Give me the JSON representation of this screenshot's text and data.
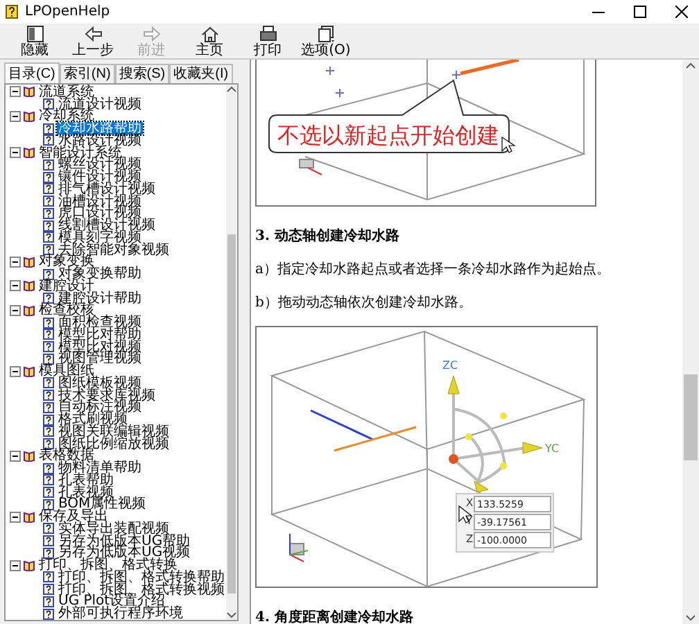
{
  "window": {
    "title": "LPOpenHelp"
  },
  "toolbar": [
    {
      "kind": "hide",
      "label": "隐藏",
      "disabled": false
    },
    {
      "kind": "back",
      "label": "上一步",
      "disabled": false
    },
    {
      "kind": "forward",
      "label": "前进",
      "disabled": true
    },
    {
      "kind": "home",
      "label": "主页",
      "disabled": false
    },
    {
      "kind": "print",
      "label": "打印",
      "disabled": false
    },
    {
      "kind": "options",
      "label": "选项(O)",
      "disabled": false
    }
  ],
  "tabs": [
    {
      "label": "目录(C)",
      "selected": true
    },
    {
      "label": "索引(N)",
      "selected": false
    },
    {
      "label": "搜索(S)",
      "selected": false
    },
    {
      "label": "收藏夹(I)",
      "selected": false
    }
  ],
  "tree": [
    {
      "label": "流道系统",
      "expanded": true,
      "selected": false,
      "children": [
        {
          "label": "流道设计视频",
          "selected": false
        }
      ]
    },
    {
      "label": "冷却系统",
      "expanded": true,
      "selected": false,
      "children": [
        {
          "label": "冷却水路帮助",
          "selected": true
        },
        {
          "label": "水路设计视频",
          "selected": false
        }
      ]
    },
    {
      "label": "智能设计系统",
      "expanded": true,
      "selected": false,
      "children": [
        {
          "label": "螺丝设计视频",
          "selected": false
        },
        {
          "label": "镶件设计视频",
          "selected": false
        },
        {
          "label": "排气槽设计视频",
          "selected": false
        },
        {
          "label": "油槽设计视频",
          "selected": false
        },
        {
          "label": "虎口设计视频",
          "selected": false
        },
        {
          "label": "线割槽设计视频",
          "selected": false
        },
        {
          "label": "模具刻字视频",
          "selected": false
        },
        {
          "label": "去除智能对象视频",
          "selected": false
        }
      ]
    },
    {
      "label": "对象变换",
      "expanded": true,
      "selected": false,
      "children": [
        {
          "label": "对象变换帮助",
          "selected": false
        }
      ]
    },
    {
      "label": "建腔设计",
      "expanded": true,
      "selected": false,
      "children": [
        {
          "label": "建腔设计帮助",
          "selected": false
        }
      ]
    },
    {
      "label": "检查校核",
      "expanded": true,
      "selected": false,
      "children": [
        {
          "label": "面积检查视频",
          "selected": false
        },
        {
          "label": "模型比对帮助",
          "selected": false
        },
        {
          "label": "模型比对视频",
          "selected": false
        },
        {
          "label": "视图管理视频",
          "selected": false
        }
      ]
    },
    {
      "label": "模具图纸",
      "expanded": true,
      "selected": false,
      "children": [
        {
          "label": "图纸模板视频",
          "selected": false
        },
        {
          "label": "技术要求库视频",
          "selected": false
        },
        {
          "label": "自动标注视频",
          "selected": false
        },
        {
          "label": "格式刷视频",
          "selected": false
        },
        {
          "label": "视图关联编辑视频",
          "selected": false
        },
        {
          "label": "图纸比例缩放视频",
          "selected": false
        }
      ]
    },
    {
      "label": "表格数据",
      "expanded": true,
      "selected": false,
      "children": [
        {
          "label": "物料清单帮助",
          "selected": false
        },
        {
          "label": "孔表帮助",
          "selected": false
        },
        {
          "label": "孔表视频",
          "selected": false
        },
        {
          "label": "BOM属性视频",
          "selected": false
        }
      ]
    },
    {
      "label": "保存及导出",
      "expanded": true,
      "selected": false,
      "children": [
        {
          "label": "实体导出装配视频",
          "selected": false
        },
        {
          "label": "另存为低版本UG帮助",
          "selected": false
        },
        {
          "label": "另存为低版本UG视频",
          "selected": false
        }
      ]
    },
    {
      "label": "打印、拆图、格式转换",
      "expanded": true,
      "selected": false,
      "children": [
        {
          "label": "打印、拆图、格式转换帮助",
          "selected": false
        },
        {
          "label": "打印、拆图、格式转换视频",
          "selected": false
        },
        {
          "label": "UG Plot设置介绍",
          "selected": false
        },
        {
          "label": "外部可执行程序环境",
          "selected": false
        }
      ]
    }
  ],
  "content": [
    {
      "kind": "callout-figure",
      "callout": "不选以新起点开始创建"
    },
    {
      "kind": "heading",
      "text": "3. 动态轴创建冷却水路"
    },
    {
      "kind": "paragraph",
      "text": "a）指定冷却水路起点或者选择一条冷却水路作为起始点。"
    },
    {
      "kind": "paragraph",
      "text": "b）拖动动态轴依次创建冷却水路。"
    },
    {
      "kind": "axis-figure",
      "axes": [
        "ZC",
        "YC"
      ],
      "coordinates": [
        {
          "label": "X",
          "value": "133.5259"
        },
        {
          "label": "Y",
          "value": "-39.17561"
        },
        {
          "label": "Z",
          "value": "-100.0000"
        }
      ]
    },
    {
      "kind": "heading",
      "text": "4. 角度距离创建冷却水路"
    }
  ]
}
